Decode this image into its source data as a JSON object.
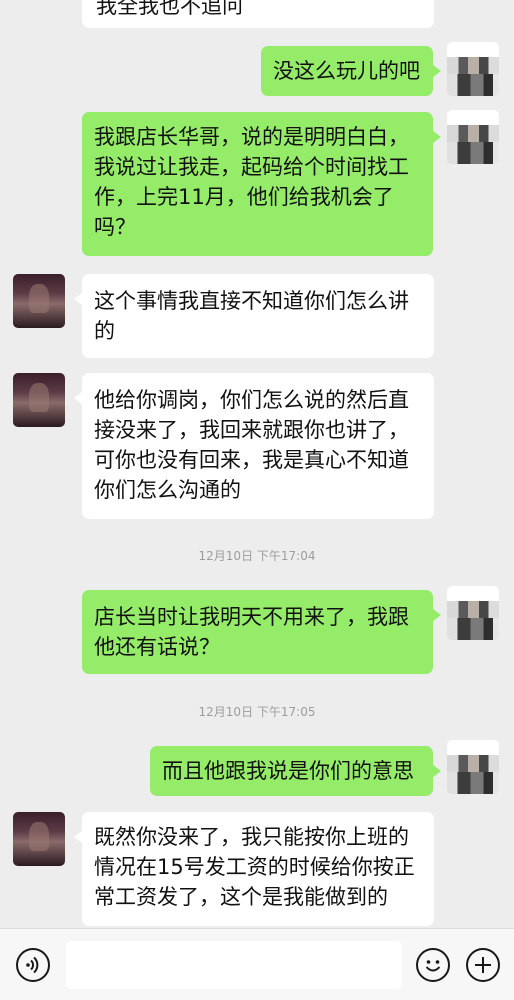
{
  "messages": [
    {
      "id": "m0",
      "side": "in",
      "text": "我全我也不追问"
    },
    {
      "id": "m1",
      "side": "out",
      "text": "没这么玩儿的吧"
    },
    {
      "id": "m2",
      "side": "out",
      "text": "我跟店长华哥，说的是明明白白，我说过让我走，起码给个时间找工作，上完11月，他们给我机会了吗？"
    },
    {
      "id": "m3",
      "side": "in",
      "text": "这个事情我直接不知道你们怎么讲的"
    },
    {
      "id": "m4",
      "side": "in",
      "text": "他给你调岗，你们怎么说的然后直接没来了，我回来就跟你也讲了，可你也没有回来，我是真心不知道你们怎么沟通的"
    },
    {
      "id": "m5",
      "side": "out",
      "text": "店长当时让我明天不用来了，我跟他还有话说？"
    },
    {
      "id": "m6",
      "side": "out",
      "text": "而且他跟我说是你们的意思"
    },
    {
      "id": "m7",
      "side": "in",
      "text": "既然你没来了，我只能按你上班的情况在15号发工资的时候给你按正常工资发了，这个是我能做到的"
    }
  ],
  "timestamps": {
    "t1": "12月10日 下午17:04",
    "t2": "12月10日 下午17:05"
  },
  "input_bar": {
    "voice_icon": "voice-icon",
    "emoji_icon": "emoji-icon",
    "plus_icon": "plus-icon",
    "input_value": ""
  },
  "colors": {
    "outgoing_bubble": "#95ec69",
    "incoming_bubble": "#ffffff",
    "background": "#ededed"
  }
}
